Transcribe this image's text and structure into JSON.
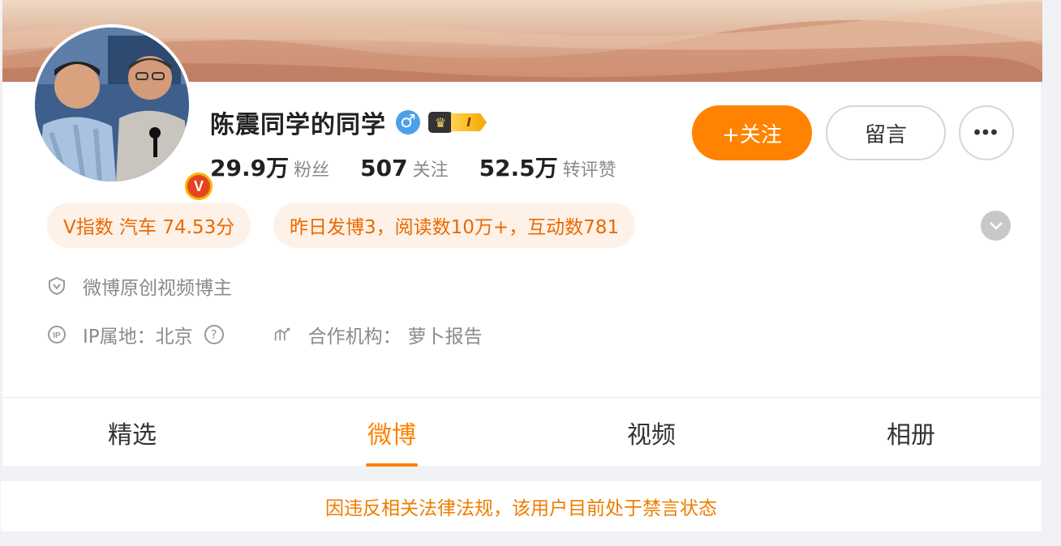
{
  "profile": {
    "name": "陈震同学的同学",
    "gender_symbol": "♂",
    "vip_level": "I",
    "verified_mark": "V",
    "stats": {
      "fans_num": "29.9万",
      "fans_label": "粉丝",
      "follow_num": "507",
      "follow_label": "关注",
      "likes_num": "52.5万",
      "likes_label": "转评赞"
    }
  },
  "actions": {
    "follow_label": "+关注",
    "message_label": "留言",
    "more_label": "•••"
  },
  "tags": {
    "v_index": "V指数 汽车 74.53分",
    "activity": "昨日发博3，阅读数10万+，互动数781"
  },
  "info": {
    "creator": "微博原创视频博主",
    "ip": "IP属地：北京",
    "org_label": "合作机构：",
    "org_value": "萝卜报告"
  },
  "tabs": [
    {
      "label": "精选"
    },
    {
      "label": "微博"
    },
    {
      "label": "视频"
    },
    {
      "label": "相册"
    }
  ],
  "active_tab": "微博",
  "notice": "因违反相关法律法规，该用户目前处于禁言状态",
  "colors": {
    "accent": "#ff8200",
    "tag_bg": "#fdf1e8",
    "gender": "#4da0e8"
  }
}
